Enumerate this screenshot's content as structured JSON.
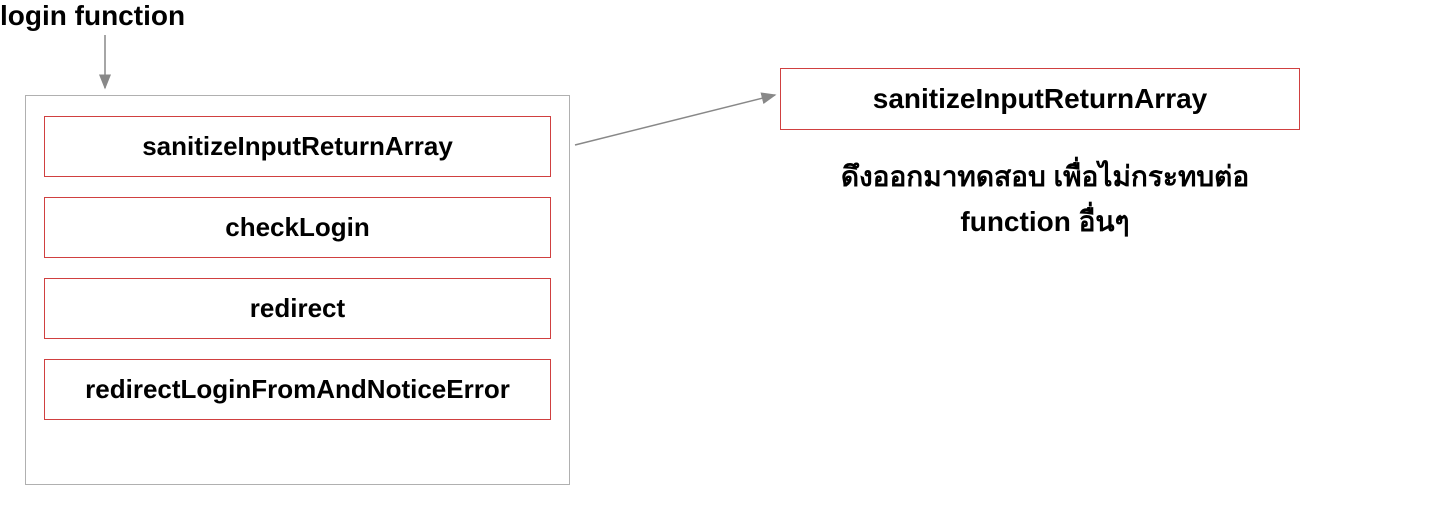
{
  "title": "login function",
  "container": {
    "functions": [
      "sanitizeInputReturnArray",
      "checkLogin",
      "redirect",
      "redirectLoginFromAndNoticeError"
    ]
  },
  "extracted": {
    "function": "sanitizeInputReturnArray",
    "caption_line1": "ดึงออกมาทดสอบ เพื่อไม่กระทบต่อ",
    "caption_line2": "function อื่นๆ"
  }
}
